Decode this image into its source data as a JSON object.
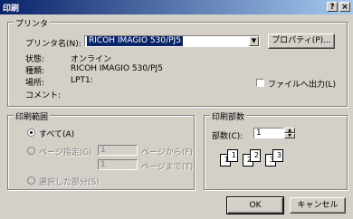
{
  "window": {
    "title": "印刷",
    "help_btn": "?",
    "close_btn": "×"
  },
  "printer": {
    "group_label": "プリンタ",
    "name_label": "プリンタ名(N):",
    "name_value": "RICOH IMAGIO 530/PJ5",
    "properties_button": "プロパティ(P)...",
    "status_label": "状態:",
    "status_value": "オンライン",
    "type_label": "種類:",
    "type_value": "RICOH IMAGIO 530/PJ5",
    "where_label": "場所:",
    "where_value": "LPT1:",
    "comment_label": "コメント:",
    "print_to_file": "ファイルへ出力(L)"
  },
  "range": {
    "group_label": "印刷範囲",
    "all": "すべて(A)",
    "pages": "ページ指定(G)",
    "from_value": "1",
    "from_label": "ページから(F)",
    "to_value": "1",
    "to_label": "ページまで(T)",
    "selection": "選択した部分(S)"
  },
  "copies": {
    "group_label": "印刷部数",
    "count_label": "部数(C):",
    "count_value": "1",
    "pages": [
      "1",
      "1",
      "2",
      "2",
      "3",
      "3"
    ]
  },
  "buttons": {
    "ok": "OK",
    "cancel": "キャンセル"
  }
}
